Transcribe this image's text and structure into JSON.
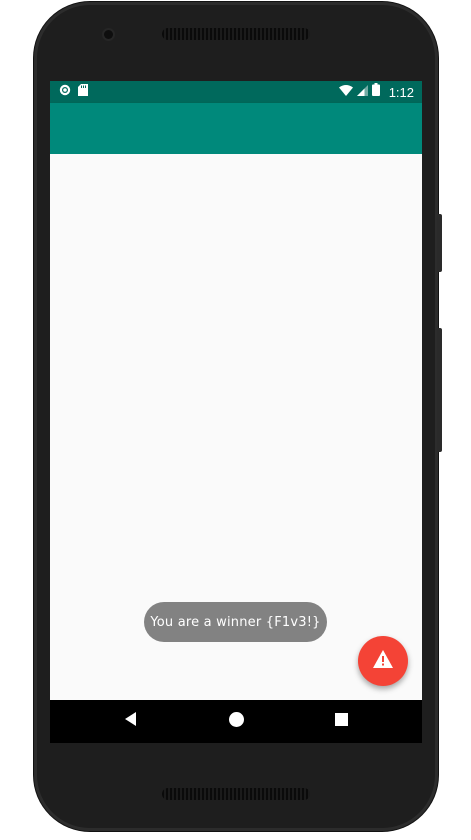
{
  "status_bar": {
    "time": "1:12",
    "left_icons": [
      "circle-notification-icon",
      "sd-card-icon"
    ],
    "right_icons": [
      "wifi-icon",
      "signal-icon",
      "battery-icon"
    ]
  },
  "toast": {
    "message": "You are a winner {F1v3!}"
  },
  "fab": {
    "icon": "warning-icon"
  },
  "navigation_bar": {
    "buttons": [
      "back-icon",
      "home-icon",
      "recents-icon"
    ]
  },
  "colors": {
    "status_bar": "#00695c",
    "app_bar": "#00897b",
    "background": "#fafafa",
    "fab": "#f44336",
    "toast": "#828282",
    "nav_bar": "#000000"
  }
}
